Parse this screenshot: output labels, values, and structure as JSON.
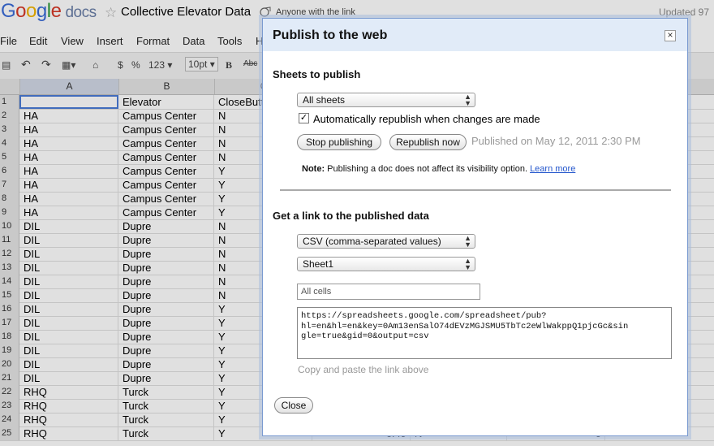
{
  "header": {
    "logo_google": [
      "G",
      "o",
      "o",
      "g",
      "l",
      "e"
    ],
    "logo_docs": "docs",
    "doc_title": "Collective Elevator Data",
    "sharing": "Anyone with the link",
    "updated": "Updated 97"
  },
  "menu": [
    "File",
    "Edit",
    "View",
    "Insert",
    "Format",
    "Data",
    "Tools",
    "H"
  ],
  "toolbar": {
    "currency": "$",
    "percent": "%",
    "number_format": "123",
    "font_size": "10pt",
    "bold": "B",
    "strike": "Abc"
  },
  "grid": {
    "columns": [
      "A",
      "B",
      "C"
    ],
    "rows": [
      {
        "n": "1",
        "a": "",
        "b": "Elevator",
        "c": "CloseButt"
      },
      {
        "n": "2",
        "a": "HA",
        "b": "Campus Center",
        "c": "N"
      },
      {
        "n": "3",
        "a": "HA",
        "b": "Campus Center",
        "c": "N"
      },
      {
        "n": "4",
        "a": "HA",
        "b": "Campus Center",
        "c": "N"
      },
      {
        "n": "5",
        "a": "HA",
        "b": "Campus Center",
        "c": "N"
      },
      {
        "n": "6",
        "a": "HA",
        "b": "Campus Center",
        "c": "Y"
      },
      {
        "n": "7",
        "a": "HA",
        "b": "Campus Center",
        "c": "Y"
      },
      {
        "n": "8",
        "a": "HA",
        "b": "Campus Center",
        "c": "Y"
      },
      {
        "n": "9",
        "a": "HA",
        "b": "Campus Center",
        "c": "Y"
      },
      {
        "n": "10",
        "a": "DIL",
        "b": "Dupre",
        "c": "N"
      },
      {
        "n": "11",
        "a": "DIL",
        "b": "Dupre",
        "c": "N"
      },
      {
        "n": "12",
        "a": "DIL",
        "b": "Dupre",
        "c": "N"
      },
      {
        "n": "13",
        "a": "DIL",
        "b": "Dupre",
        "c": "N"
      },
      {
        "n": "14",
        "a": "DIL",
        "b": "Dupre",
        "c": "N"
      },
      {
        "n": "15",
        "a": "DIL",
        "b": "Dupre",
        "c": "N"
      },
      {
        "n": "16",
        "a": "DIL",
        "b": "Dupre",
        "c": "Y"
      },
      {
        "n": "17",
        "a": "DIL",
        "b": "Dupre",
        "c": "Y"
      },
      {
        "n": "18",
        "a": "DIL",
        "b": "Dupre",
        "c": "Y"
      },
      {
        "n": "19",
        "a": "DIL",
        "b": "Dupre",
        "c": "Y"
      },
      {
        "n": "20",
        "a": "DIL",
        "b": "Dupre",
        "c": "Y"
      },
      {
        "n": "21",
        "a": "DIL",
        "b": "Dupre",
        "c": "Y"
      },
      {
        "n": "22",
        "a": "RHQ",
        "b": "Turck",
        "c": "Y"
      },
      {
        "n": "23",
        "a": "RHQ",
        "b": "Turck",
        "c": "Y"
      },
      {
        "n": "24",
        "a": "RHQ",
        "b": "Turck",
        "c": "Y"
      },
      {
        "n": "25",
        "a": "RHQ",
        "b": "Turck",
        "c": "Y",
        "d": "6.49",
        "e": "N",
        "f": "0"
      }
    ]
  },
  "dialog": {
    "title": "Publish to the web",
    "close": "×",
    "sheets_heading": "Sheets to publish",
    "sheets_select": "All sheets",
    "auto_republish_checked": true,
    "auto_republish_label": "Automatically republish when changes are made",
    "stop_button": "Stop publishing",
    "republish_button": "Republish now",
    "published_on": "Published on May 12, 2011 2:30 PM",
    "note_bold": "Note:",
    "note_text": " Publishing a doc does not affect its visibility option. ",
    "learn_more": "Learn more",
    "link_heading": "Get a link to the published data",
    "format_select": "CSV (comma-separated values)",
    "sheet_select": "Sheet1",
    "range_placeholder": "All cells",
    "url": "https://spreadsheets.google.com/spreadsheet/pub?\nhl=en&hl=en&key=0Am13enSalO74dEVzMGJSMU5TbTc2eWlWakppQ1pjcGc&sin\ngle=true&gid=0&output=csv",
    "copy_hint": "Copy and paste the link above",
    "close_button": "Close"
  }
}
